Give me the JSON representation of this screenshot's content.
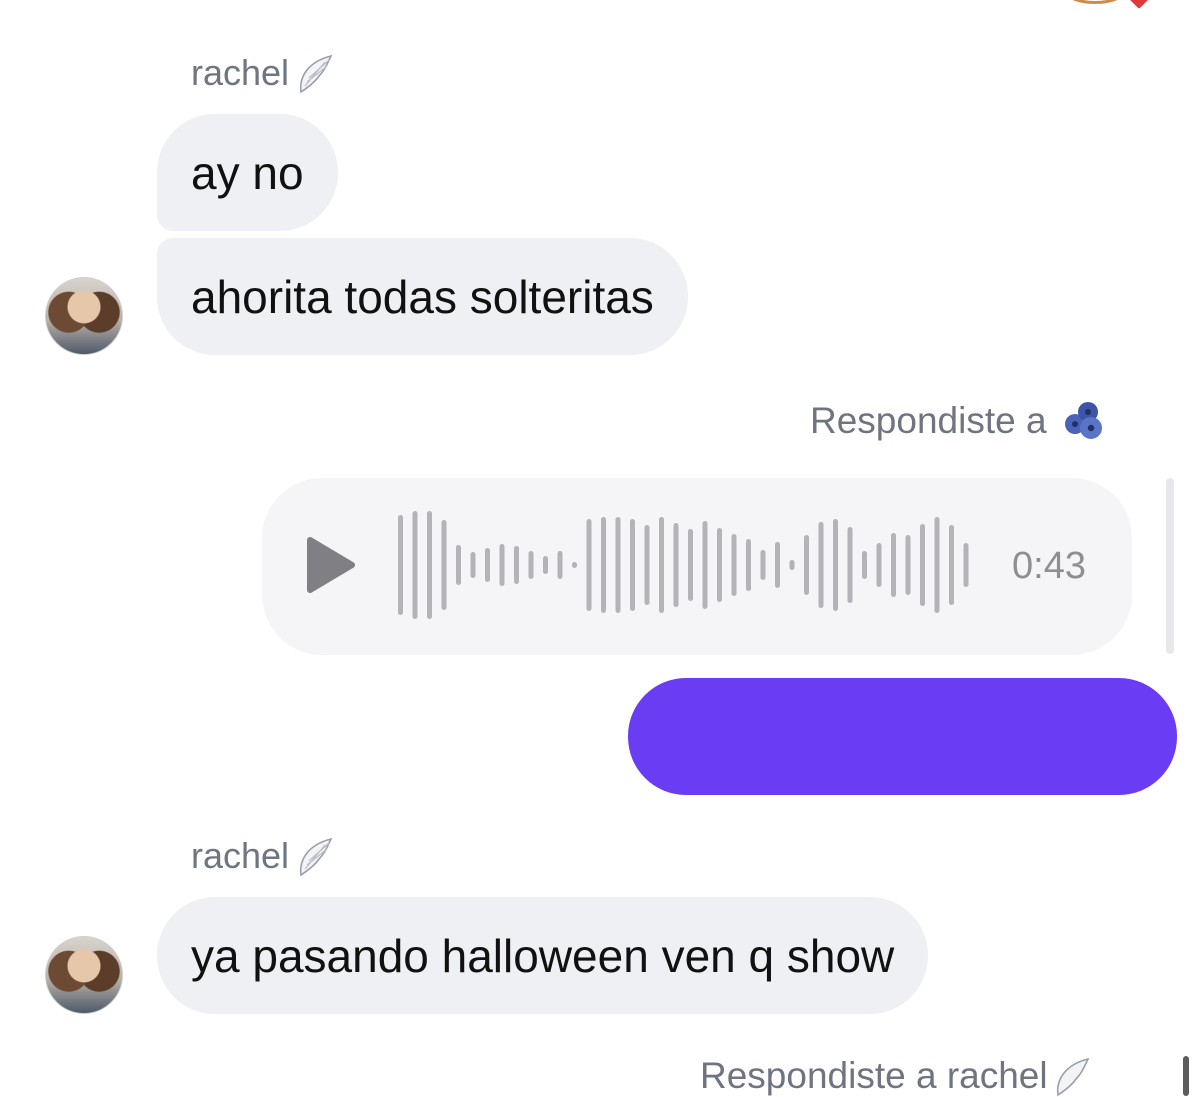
{
  "messages": {
    "group1": {
      "sender_name": "rachel",
      "bubble1": "ay no",
      "bubble2": "ahorita todas solteritas"
    },
    "reply": {
      "label": "Respondiste a"
    },
    "voice_message": {
      "duration": "0:43"
    },
    "group2": {
      "sender_name": "rachel",
      "bubble1": "ya pasando halloween ven q show"
    },
    "bottom_reply": {
      "label": "Respondiste a rachel"
    }
  },
  "colors": {
    "incoming_bubble": "#eff0f3",
    "outgoing_bubble": "#6a3df5",
    "voice_bubble": "#f5f5f7",
    "secondary_text": "#707582"
  },
  "icons": {
    "sender_badge": "angel-wing-icon",
    "reply_avatar": "blueberries-icon",
    "play": "play-icon"
  }
}
